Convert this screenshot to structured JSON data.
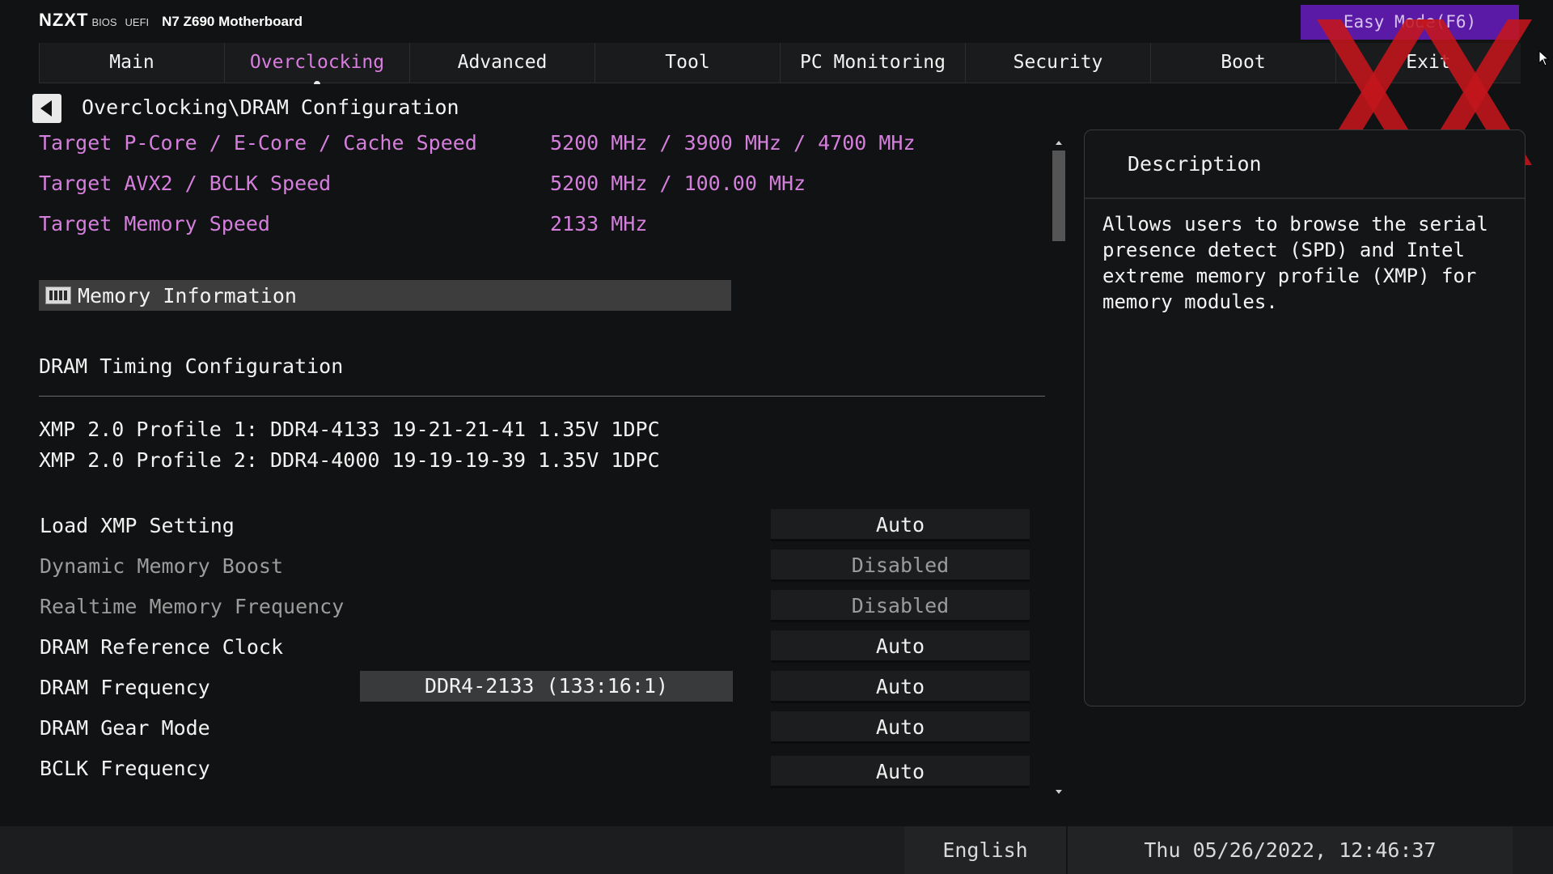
{
  "header": {
    "logo": "NZXT",
    "bios_tag": "BIOS",
    "uefi_tag": "UEFI",
    "board": "N7 Z690 Motherboard",
    "easy_mode_label": "Easy Mode(F6)"
  },
  "tabs": [
    {
      "label": "Main"
    },
    {
      "label": "Overclocking",
      "active": true
    },
    {
      "label": "Advanced"
    },
    {
      "label": "Tool"
    },
    {
      "label": "PC Monitoring"
    },
    {
      "label": "Security"
    },
    {
      "label": "Boot"
    },
    {
      "label": "Exit"
    }
  ],
  "breadcrumb": "Overclocking\\DRAM Configuration",
  "targets": [
    {
      "label": "Target P-Core / E-Core / Cache Speed",
      "value": "5200 MHz / 3900 MHz / 4700 MHz"
    },
    {
      "label": "Target AVX2 / BCLK Speed",
      "value": "5200 MHz / 100.00 MHz"
    },
    {
      "label": "Target Memory Speed",
      "value": "2133 MHz"
    }
  ],
  "memory_info_label": "Memory Information",
  "dram_timing_label": "DRAM Timing Configuration",
  "xmp_profiles": [
    "XMP 2.0 Profile 1: DDR4-4133 19-21-21-41 1.35V 1DPC",
    "XMP 2.0 Profile 2: DDR4-4000 19-19-19-39 1.35V 1DPC"
  ],
  "settings": [
    {
      "label": "Load XMP Setting",
      "value": "Auto",
      "enabled": true
    },
    {
      "label": "Dynamic Memory Boost",
      "value": "Disabled",
      "enabled": false
    },
    {
      "label": "Realtime Memory Frequency",
      "value": "Disabled",
      "enabled": false
    },
    {
      "label": "DRAM Reference Clock",
      "value": "Auto",
      "enabled": true
    },
    {
      "label": "DRAM Frequency",
      "value": "Auto",
      "enabled": true,
      "display": "DDR4-2133 (133:16:1)"
    },
    {
      "label": "DRAM Gear Mode",
      "value": "Auto",
      "enabled": true
    },
    {
      "label": "BCLK Frequency",
      "value": "Auto",
      "enabled": true
    }
  ],
  "description": {
    "title": "Description",
    "text": "Allows users to browse the serial presence detect (SPD) and Intel extreme memory profile (XMP) for memory modules."
  },
  "footer": {
    "language": "English",
    "datetime": "Thu 05/26/2022, 12:46:37"
  },
  "colors": {
    "accent_purple": "#5a1aa6",
    "target_pink": "#d57fdd",
    "watermark_red": "#c4161c"
  },
  "icons": [
    "back-arrow-icon",
    "memory-module-icon",
    "mouse-cursor-icon",
    "scroll-up-icon",
    "scroll-down-icon"
  ]
}
